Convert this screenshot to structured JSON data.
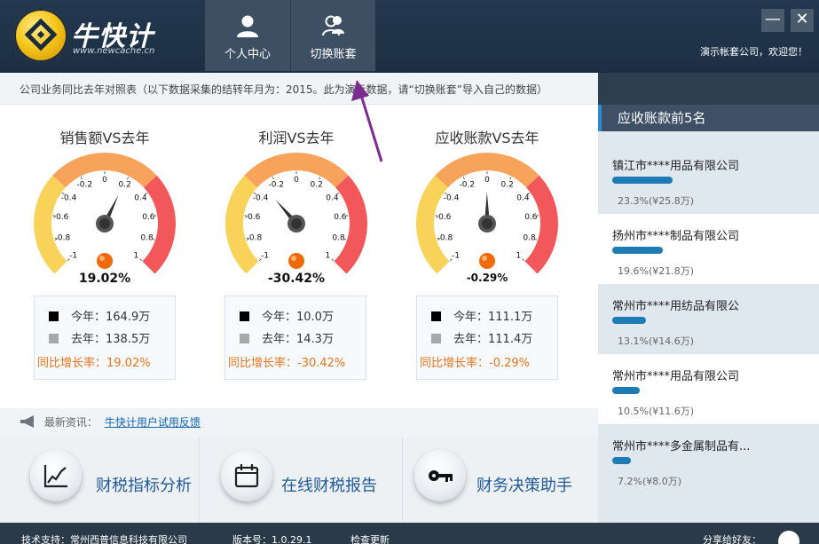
{
  "app": {
    "brand": "牛快计",
    "url": "www.newcache.cn",
    "welcome": "演示帐套公司，欢迎您！"
  },
  "nav": [
    {
      "label": "个人中心",
      "icon": "user-icon"
    },
    {
      "label": "切换账套",
      "icon": "switch-account-icon"
    }
  ],
  "window": {
    "minimize": "—",
    "close": "✕"
  },
  "notice": "公司业务同比去年对照表（以下数据采集的结转年月为：2015。此为演示数据，请“切换账套”导入自己的数据）",
  "gauge_ticks": [
    "-1",
    "-0.8",
    "-0.6",
    "-0.4",
    "-0.2",
    "0",
    "0.2",
    "0.4",
    "0.6",
    "0.8",
    "1"
  ],
  "gauges": [
    {
      "title": "销售额VS去年",
      "value_text": "19.02%",
      "value": 0.1902,
      "this_year": "今年：164.9万",
      "last_year": "去年：138.5万",
      "rate": "同比增长率：19.02%"
    },
    {
      "title": "利润VS去年",
      "value_text": "-30.42%",
      "value": -0.3042,
      "this_year": "今年：10.0万",
      "last_year": "去年：14.3万",
      "rate": "同比增长率：-30.42%"
    },
    {
      "title": "应收账款VS去年",
      "value_text": "-0.29%",
      "value": -0.0029,
      "this_year": "今年：111.1万",
      "last_year": "去年：111.4万",
      "rate": "同比增长率：-0.29%"
    }
  ],
  "colors": {
    "arc_low": "#f9d25a",
    "arc_mid": "#f7a35c",
    "arc_high": "#f2575a",
    "this_year": "#000000",
    "last_year": "#a8a8a8",
    "rate": "#e8731c",
    "accent": "#1f7bb3"
  },
  "news": {
    "label": "最新资讯：",
    "link": "牛快计用户试用反馈"
  },
  "tools": [
    {
      "label": "财税指标分析",
      "icon": "chart-trend-icon"
    },
    {
      "label": "在线财税报告",
      "icon": "calendar-report-icon"
    },
    {
      "label": "财务决策助手",
      "icon": "key-icon"
    }
  ],
  "receivables": {
    "title": "应收账款前5名",
    "items": [
      {
        "name": "镇江市****用品有限公司",
        "value": "23.3%(¥25.8万)",
        "pct": 0.233
      },
      {
        "name": "扬州市****制品有限公司",
        "value": "19.6%(¥21.8万)",
        "pct": 0.196
      },
      {
        "name": " 常州市****用纺品有限公",
        "value": "13.1%(¥14.6万)",
        "pct": 0.131
      },
      {
        "name": "常州市****用品有限公司",
        "value": "10.5%(¥11.6万)",
        "pct": 0.105
      },
      {
        "name": "常州市****多金属制品有...",
        "value": "7.2%(¥8.0万)",
        "pct": 0.072
      }
    ]
  },
  "footer": {
    "support": "技术支持：常州西普信息科技有限公司",
    "version": "版本号：1.0.29.1",
    "check_update": "检查更新",
    "share": "分享给好友："
  }
}
